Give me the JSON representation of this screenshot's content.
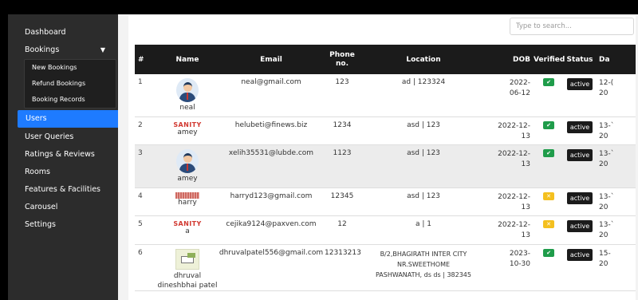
{
  "sidebar": {
    "items": [
      {
        "label": "Dashboard"
      },
      {
        "label": "Bookings",
        "expanded": true
      },
      {
        "label": "Users",
        "active": true
      },
      {
        "label": "User Queries"
      },
      {
        "label": "Ratings & Reviews"
      },
      {
        "label": "Rooms"
      },
      {
        "label": "Features & Facilities"
      },
      {
        "label": "Carousel"
      },
      {
        "label": "Settings"
      }
    ],
    "bookings_submenu": [
      "New Bookings",
      "Refund Bookings",
      "Booking Records"
    ]
  },
  "search": {
    "placeholder": "Type to search..."
  },
  "table": {
    "headers": [
      "#",
      "Name",
      "Email",
      "Phone\nno.",
      "Location",
      "DOB",
      "Verified",
      "Status",
      "Da"
    ],
    "rows": [
      {
        "num": "1",
        "avatar": "avatar-man",
        "name": "neal",
        "email": "neal@gmail.com",
        "phone": "123",
        "location": "ad | 123324",
        "dob": "2022-\n06-12",
        "verified": "true",
        "status": "active",
        "date": "12-(\n20"
      },
      {
        "num": "2",
        "avatar": "sanity-logo",
        "name": "amey",
        "logo_text": "SANITY",
        "email": "helubeti@finews.biz",
        "phone": "1234",
        "location": "asd | 123",
        "dob": "2022-12-\n13",
        "verified": "true",
        "status": "active",
        "date": "13-`\n20"
      },
      {
        "num": "3",
        "avatar": "avatar-man",
        "name": "amey",
        "email": "xelih35531@lubde.com",
        "phone": "1123",
        "location": "asd | 123",
        "dob": "2022-12-\n13",
        "verified": "true",
        "status": "active",
        "date": "13-`\n20"
      },
      {
        "num": "4",
        "avatar": "stamp-logo",
        "name": "harry",
        "email": "harryd123@gmail.com",
        "phone": "12345",
        "location": "asd | 123",
        "dob": "2022-12-\n13",
        "verified": "false",
        "status": "active",
        "date": "13-`\n20"
      },
      {
        "num": "5",
        "avatar": "sanity-logo",
        "name": "a",
        "logo_text": "SANITY",
        "email": "cejika9124@paxven.com",
        "phone": "12",
        "location": "a | 1",
        "dob": "2022-12-\n13",
        "verified": "false",
        "status": "active",
        "date": "13-`\n20"
      },
      {
        "num": "6",
        "avatar": "photo-thumb",
        "name": "dhruval\ndineshbhai patel",
        "email": "dhruvalpatel556@gmail.com",
        "phone": "12313213",
        "location": "B/2,BHAGIRATH INTER CITY NR.SWEETHOME\nPASHWANATH, ds ds | 382345",
        "dob": "2023-\n10-30",
        "verified": "true",
        "status": "active",
        "date": "15-\n20"
      }
    ]
  },
  "colors": {
    "sidebar_bg": "#2c2c2c",
    "active_blue": "#1e7bff",
    "header_dark": "#1b1b1b",
    "verified_green": "#1f9c4a",
    "unverified_yellow": "#f4c01f"
  }
}
